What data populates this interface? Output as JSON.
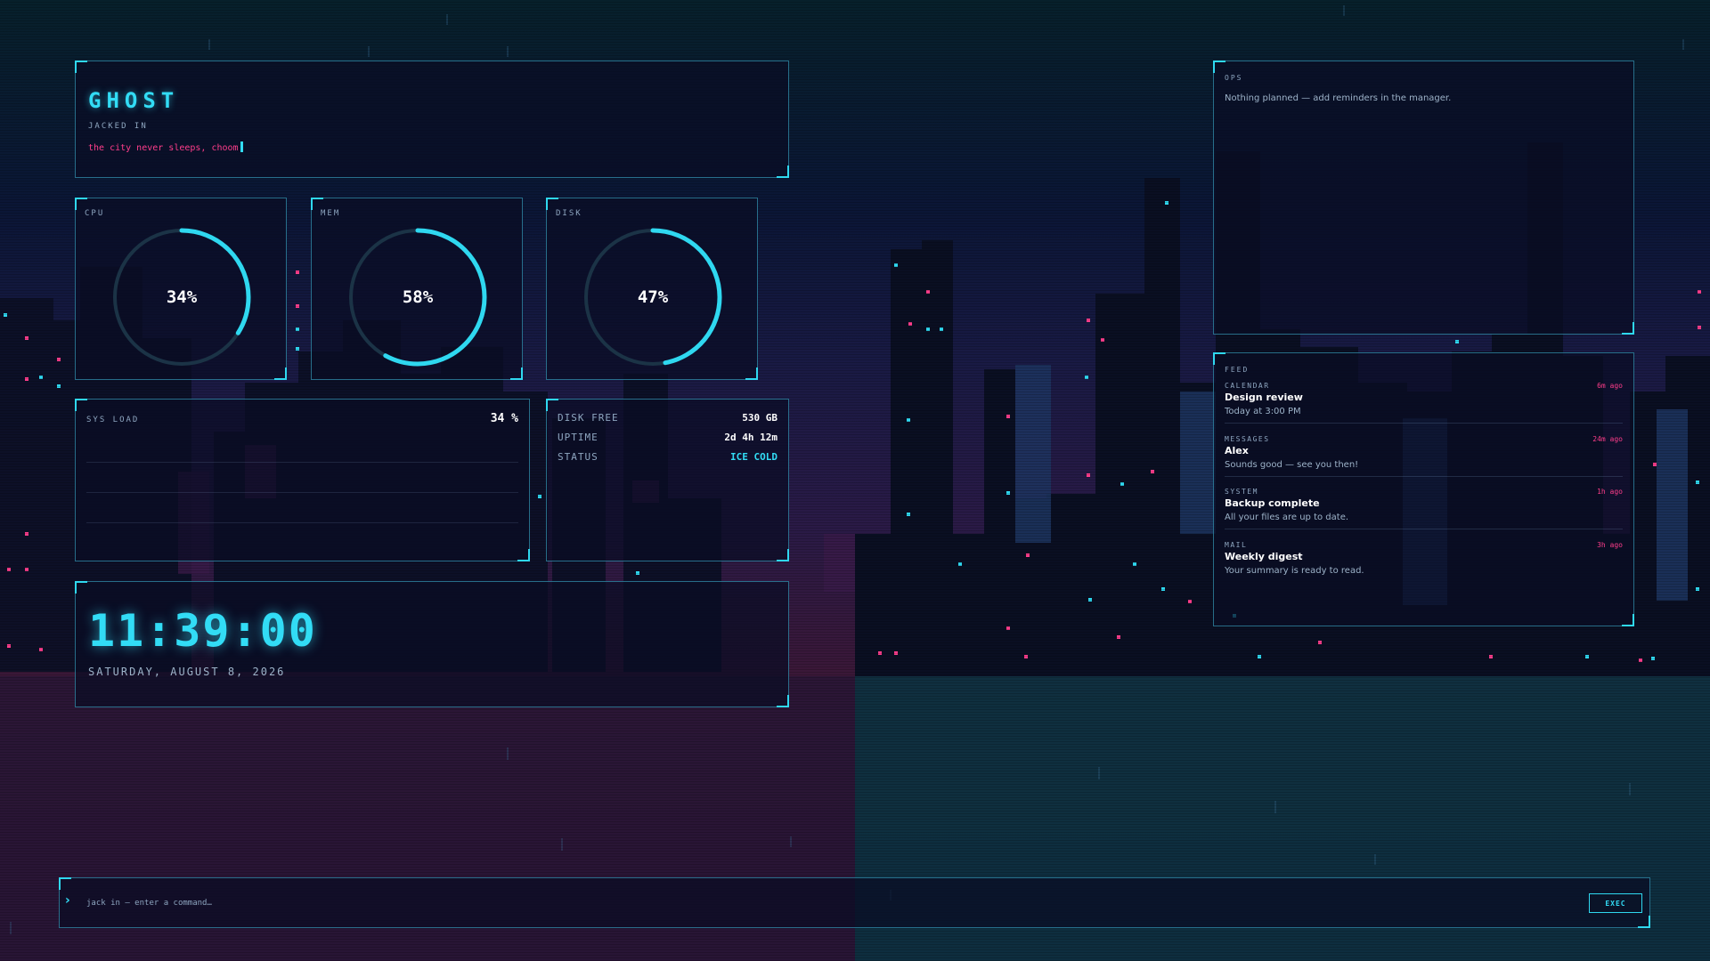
{
  "header": {
    "title": "GHOST",
    "subtitle": "JACKED IN",
    "tagline": "the city never sleeps, choom"
  },
  "gauges": [
    {
      "label": "CPU",
      "value": 34,
      "display": "34%"
    },
    {
      "label": "MEM",
      "value": 58,
      "display": "58%"
    },
    {
      "label": "DISK",
      "value": 47,
      "display": "47%"
    }
  ],
  "sys_load": {
    "label": "SYS LOAD",
    "value": "34 %"
  },
  "stats": {
    "disk_free_label": "DISK FREE",
    "disk_free_value": "530 GB",
    "uptime_label": "UPTIME",
    "uptime_value": "2d 4h 12m",
    "status_label": "STATUS",
    "status_value": "ICE COLD"
  },
  "clock": {
    "time": "11:39:00",
    "date": "SATURDAY, AUGUST 8, 2026"
  },
  "ops": {
    "label": "OPS",
    "message": "Nothing planned — add reminders in the manager."
  },
  "feed": {
    "label": "FEED",
    "items": [
      {
        "source": "CALENDAR",
        "ago": "6m ago",
        "title": "Design review",
        "body": "Today at 3:00 PM"
      },
      {
        "source": "MESSAGES",
        "ago": "24m ago",
        "title": "Alex",
        "body": "Sounds good — see you then!"
      },
      {
        "source": "SYSTEM",
        "ago": "1h ago",
        "title": "Backup complete",
        "body": "All your files are up to date."
      },
      {
        "source": "MAIL",
        "ago": "3h ago",
        "title": "Weekly digest",
        "body": "Your summary is ready to read."
      }
    ]
  },
  "command": {
    "prompt": "›",
    "placeholder": "jack in — enter a command…",
    "exec_label": "EXEC"
  },
  "colors": {
    "accent": "#32dcf5",
    "pink": "#ff3d8b",
    "panel_border": "#2fd8f0"
  }
}
